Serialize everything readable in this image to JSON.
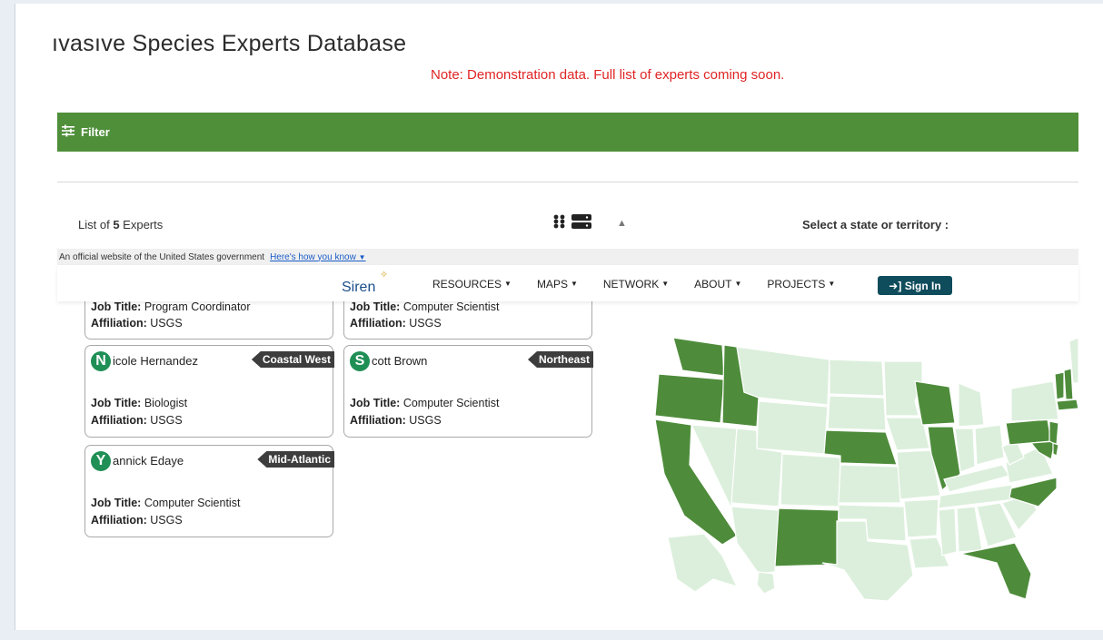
{
  "page": {
    "title": "ıvasıve Species Experts Database",
    "note": "Note: Demonstration data. Full list of experts coming soon."
  },
  "filter": {
    "label": "Filter"
  },
  "list": {
    "prefix": "List of",
    "count": "5",
    "suffix": "Experts"
  },
  "map_section": {
    "label": "Select a state or territory :"
  },
  "gov_banner": {
    "text": "An official website of the United States government",
    "link": "Here's how you know"
  },
  "navbar": {
    "logo": "Siren",
    "items": [
      {
        "label": "RESOURCES"
      },
      {
        "label": "MAPS"
      },
      {
        "label": "NETWORK"
      },
      {
        "label": "ABOUT"
      },
      {
        "label": "PROJECTS"
      }
    ],
    "signin": "Sign In"
  },
  "experts": [
    {
      "job_label": "Job Title:",
      "job": "Program Coordinator",
      "aff_label": "Affiliation:",
      "affiliation": "USGS"
    },
    {
      "job_label": "Job Title:",
      "job": "Computer Scientist",
      "aff_label": "Affiliation:",
      "affiliation": "USGS"
    },
    {
      "initial": "N",
      "name_rest": "icole Hernandez",
      "region": "Coastal West",
      "job_label": "Job Title:",
      "job": "Biologist",
      "aff_label": "Affiliation:",
      "affiliation": "USGS"
    },
    {
      "initial": "S",
      "name_rest": "cott Brown",
      "region": "Northeast",
      "job_label": "Job Title:",
      "job": "Computer Scientist",
      "aff_label": "Affiliation:",
      "affiliation": "USGS"
    },
    {
      "initial": "Y",
      "name_rest": "annick Edaye",
      "region": "Mid-Atlantic",
      "job_label": "Job Title:",
      "job": "Computer Scientist",
      "aff_label": "Affiliation:",
      "affiliation": "USGS"
    }
  ],
  "colors": {
    "filter_bar": "#4f8f3a",
    "note": "#e02424",
    "map_selected": "#4e8c3b",
    "map_default": "#dcefdc",
    "avatar": "#1f8f55",
    "signin": "#0f4c5c"
  }
}
